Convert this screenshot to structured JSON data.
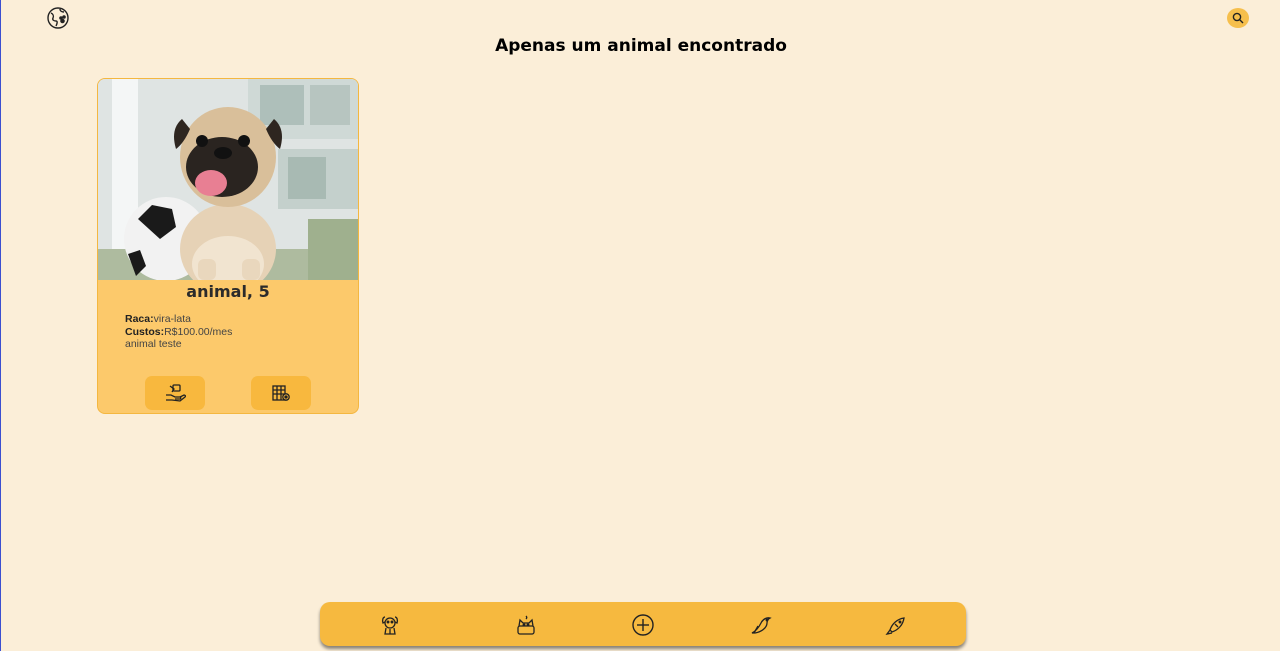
{
  "header": {
    "logo_icon": "globe-paw-icon",
    "search_icon": "search-icon"
  },
  "page": {
    "title": "Apenas um animal encontrado"
  },
  "card": {
    "image_alt": "pug",
    "name": "animal, 5",
    "breed_label": "Raca:",
    "breed_value": "vira-lata",
    "cost_label": "Custos:",
    "cost_value": "R$100.00/mes",
    "description": "animal teste",
    "actions": [
      {
        "icon": "adopt-hand-icon"
      },
      {
        "icon": "shelter-location-icon"
      }
    ]
  },
  "bottom_nav": {
    "items": [
      {
        "icon": "dog-icon"
      },
      {
        "icon": "cat-icon"
      },
      {
        "icon": "add-circle-icon"
      },
      {
        "icon": "bird-icon"
      },
      {
        "icon": "fish-icon"
      }
    ]
  },
  "colors": {
    "background": "#fbeed8",
    "accent": "#f6b93f",
    "card": "#fcc96b"
  }
}
